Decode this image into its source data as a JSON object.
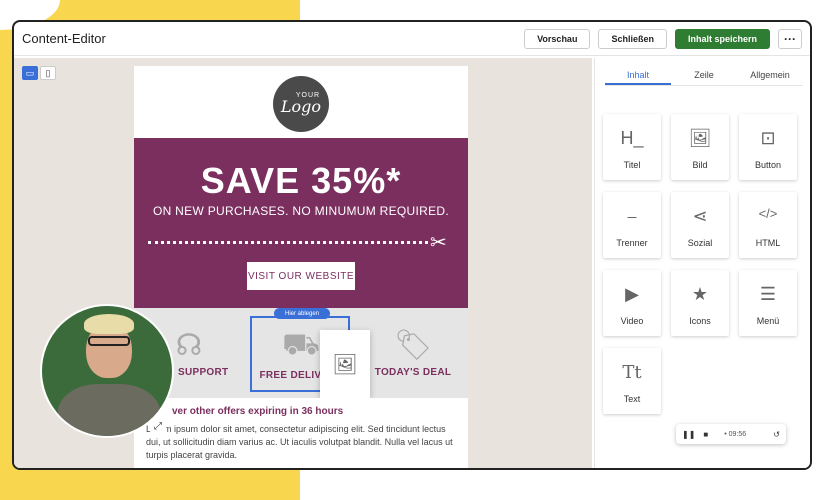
{
  "app": {
    "title": "Content-Editor",
    "preview_label": "Vorschau",
    "close_label": "Schließen",
    "save_label": "Inhalt speichern",
    "more_label": "···"
  },
  "email": {
    "logo_small": "YOUR",
    "logo_big": "Logo",
    "promo_title": "SAVE 35%*",
    "promo_sub": "ON NEW PURCHASES. NO MINUMUM REQUIRED.",
    "visit_button": "VISIT OUR WEBSITE",
    "features": [
      {
        "label": "SUPPORT",
        "icon": "headset-icon"
      },
      {
        "label": "FREE DELIVERY",
        "icon": "truck-icon"
      },
      {
        "label": "TODAY'S DEAL",
        "icon": "tag-icon"
      }
    ],
    "drop_tag": "Hier ablegen",
    "text_heading": "ver other offers expiring in 36 hours",
    "text_body": "Lorem ipsum dolor sit amet, consectetur adipiscing elit. Sed tincidunt lectus dui, ut sollicitudin diam varius ac. Ut iaculis volutpat blandit. Nulla vel lacus ut turpis placerat gravida."
  },
  "panel": {
    "tabs": [
      "Inhalt",
      "Zeile",
      "Allgemein"
    ],
    "tiles": [
      {
        "label": "Titel",
        "icon": "heading-icon",
        "glyph": "H_"
      },
      {
        "label": "Bild",
        "icon": "image-icon",
        "glyph": "🖼"
      },
      {
        "label": "Button",
        "icon": "button-icon",
        "glyph": "⊡"
      },
      {
        "label": "Trenner",
        "icon": "divider-icon",
        "glyph": "⎯"
      },
      {
        "label": "Sozial",
        "icon": "share-icon",
        "glyph": "⋖"
      },
      {
        "label": "HTML",
        "icon": "code-icon",
        "glyph": "</>"
      },
      {
        "label": "Video",
        "icon": "video-icon",
        "glyph": "▶"
      },
      {
        "label": "Icons",
        "icon": "star-icon",
        "glyph": "★"
      },
      {
        "label": "Menü",
        "icon": "menu-icon",
        "glyph": "☰"
      },
      {
        "label": "Text",
        "icon": "text-icon",
        "glyph": "Tt"
      }
    ]
  },
  "player": {
    "time": "• 09:56"
  }
}
